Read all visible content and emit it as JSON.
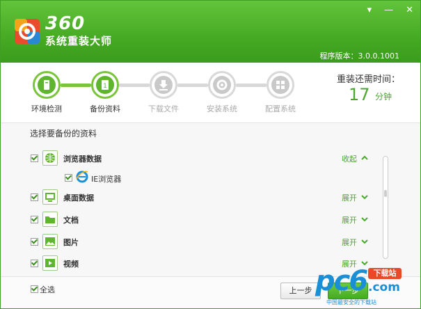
{
  "app": {
    "logo_number": "360",
    "logo_name": "系统重装大师",
    "version": "程序版本：3.0.0.1001"
  },
  "window_controls": {
    "menu": "▾",
    "minimize": "—",
    "close": "✕"
  },
  "steps": [
    {
      "label": "环境检测",
      "state": "done"
    },
    {
      "label": "备份资料",
      "state": "active"
    },
    {
      "label": "下载文件",
      "state": "pending"
    },
    {
      "label": "安装系统",
      "state": "pending"
    },
    {
      "label": "配置系统",
      "state": "pending"
    }
  ],
  "time_remaining": {
    "title": "重装还需时间：",
    "value": "17",
    "unit": "分钟"
  },
  "backup": {
    "section_title": "选择要备份的资料",
    "items": [
      {
        "label": "浏览器数据",
        "toggle": "收起",
        "checked": true,
        "icon": "globe-icon"
      },
      {
        "label": "IE浏览器",
        "checked": true,
        "icon": "ie-icon"
      },
      {
        "label": "桌面数据",
        "toggle": "展开",
        "checked": true,
        "icon": "desktop-icon"
      },
      {
        "label": "文档",
        "toggle": "展开",
        "checked": true,
        "icon": "folder-icon"
      },
      {
        "label": "图片",
        "toggle": "展开",
        "checked": true,
        "icon": "picture-icon"
      },
      {
        "label": "视频",
        "toggle": "展开",
        "checked": true,
        "icon": "video-icon"
      }
    ]
  },
  "footer": {
    "select_all": "全选",
    "prev": "上一步",
    "next": "下一步"
  },
  "watermark": {
    "brand": "pc6",
    "badge": "下载站",
    "domain": ".com",
    "slogan": "中国最安全的下载站"
  },
  "colors": {
    "brand_green": "#46aa24",
    "accent_blue": "#1a8fd6"
  }
}
